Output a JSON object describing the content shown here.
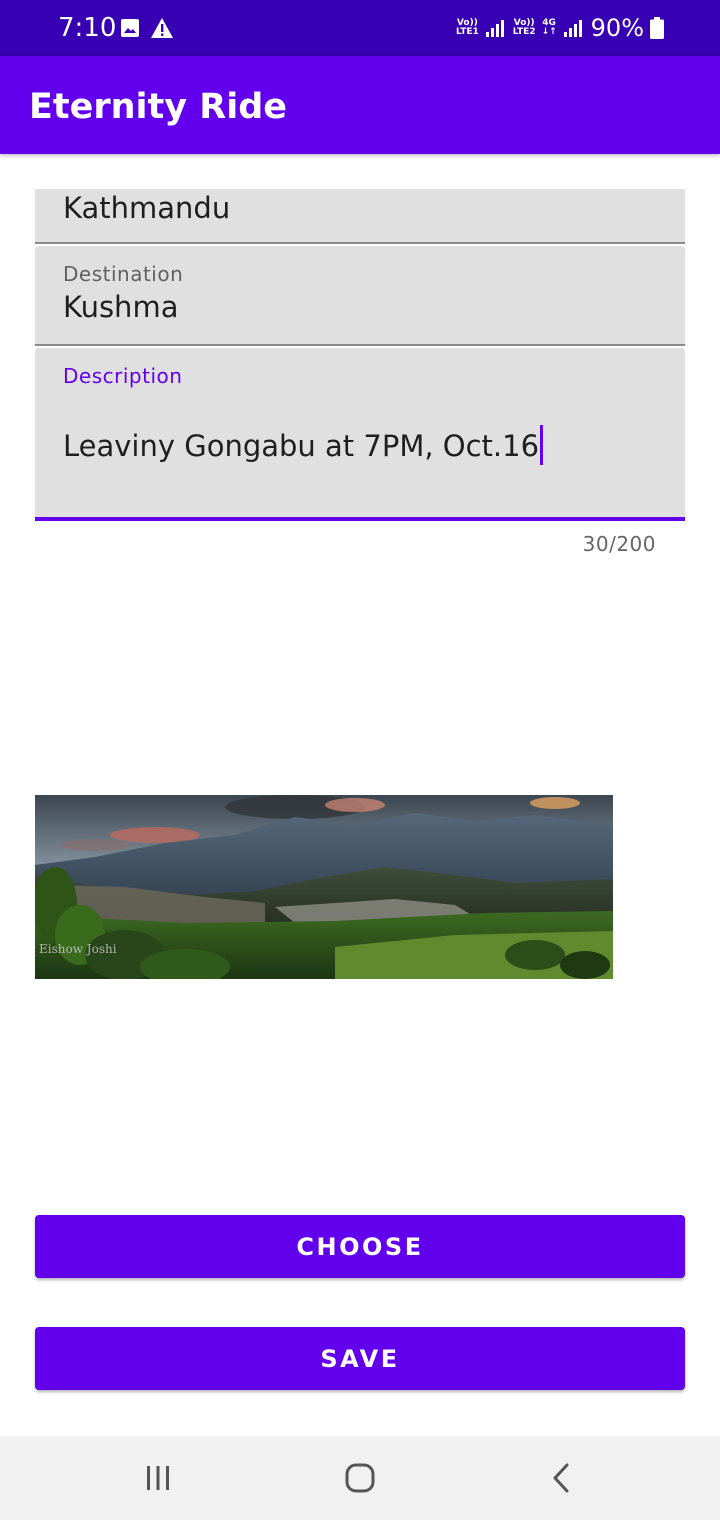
{
  "status_bar": {
    "time": "7:10",
    "icons": [
      "image-icon",
      "warning-icon",
      "volte-lte1-icon",
      "signal-icon",
      "volte-lte2-icon",
      "4g-data-icon",
      "signal-icon",
      "battery-icon"
    ],
    "net1_top": "Vo))",
    "net1_bottom": "LTE1",
    "net2_top": "Vo))",
    "net2_bottom": "LTE2",
    "data_top": "4G",
    "data_bottom": "↓↑",
    "battery": "90%"
  },
  "app_bar": {
    "title": "Eternity Ride"
  },
  "form": {
    "origin_value": "Kathmandu",
    "destination_label": "Destination",
    "destination_value": "Kushma",
    "description_label": "Description",
    "description_value": "Leaviny Gongabu at 7PM, Oct.16",
    "description_counter": "30/200"
  },
  "image": {
    "watermark": "Eishow Joshi"
  },
  "buttons": {
    "choose_label": "CHOOSE",
    "save_label": "SAVE"
  },
  "nav_bar": {
    "icons": [
      "recent-apps-icon",
      "home-icon",
      "back-icon"
    ]
  },
  "colors": {
    "status_bar": "#3700b3",
    "primary": "#6200ee",
    "field_bg": "#e0e0e0",
    "nav_bg": "#f1f1f1"
  }
}
